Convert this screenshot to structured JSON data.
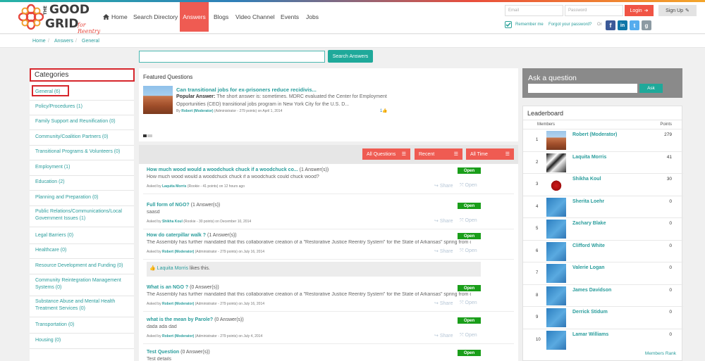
{
  "header": {
    "logo": {
      "line1": "THE",
      "line2": "GOOD",
      "line3": "GRID",
      "tagline": "for Reentry"
    },
    "nav": [
      {
        "label": "Home",
        "icon": "home-icon"
      },
      {
        "label": "Search Directory"
      },
      {
        "label": "Answers",
        "active": true
      },
      {
        "label": "Blogs"
      },
      {
        "label": "Video Channel"
      },
      {
        "label": "Events"
      },
      {
        "label": "Jobs"
      }
    ],
    "email_placeholder": "Email",
    "password_placeholder": "Password",
    "login_label": "Login",
    "signup_label": "Sign Up",
    "remember_label": "Remember me",
    "forgot_label": "Forgot your password?",
    "or_label": "Or",
    "social_icons": [
      "facebook-icon",
      "linkedin-icon",
      "twitter-icon",
      "google-icon"
    ]
  },
  "breadcrumb": [
    "Home",
    "Answers",
    "General"
  ],
  "search": {
    "button_label": "Search Answers"
  },
  "categories": {
    "title": "Categories",
    "items": [
      "General (6)",
      "Policy/Procedures (1)",
      "Family Support and Reunification (0)",
      "Community/Coalition Partners (0)",
      "Transitional Programs & Volunteers (0)",
      "Employment (1)",
      "Education (2)",
      "Planning and Preparation (0)",
      "Public Relations/Communications/Local Government Issues (1)",
      "Legal Barriers (0)",
      "Healthcare (0)",
      "Resource Development and Funding (0)",
      "Community Reintegration Management Systems (0)",
      "Substance Abuse and Mental Health Treatment Services (0)",
      "Transportation (0)",
      "Housing (0)"
    ]
  },
  "featured": {
    "title": "Featured Questions",
    "question": "Can transitional jobs for ex-prisoners reduce recidivis...",
    "popular_label": "Popular Answer:",
    "answer_line1": "The short answer is: sometimes. MDRC evaluated the Center for Employment",
    "answer_line2": "Opportunities (CEO) transitional jobs program in New York City for the U.S. D...",
    "meta_by": "By",
    "meta_user": "Robert (Moderator)",
    "meta_rest": "(Administrator - 279 points)  on April 1, 2014",
    "likes": "1"
  },
  "filters": [
    "All Questions",
    "Recent",
    "All Time"
  ],
  "questions": [
    {
      "title": "How much wood would a woodchuck chuck if a woodchuck co...",
      "count": "(1 Answer(s))",
      "excerpt": "How much wood would a woodchuck chuck if a woodchuck could chuck wood?",
      "asked": "Asked by",
      "user": "Laquita Morris",
      "meta": "(Rookie - 41 points)  on 12 hours ago",
      "status": "Open"
    },
    {
      "title": "Full form of NGO?",
      "count": "(1 Answer(s))",
      "excerpt": "saasd",
      "asked": "Asked by",
      "user": "Shikha Koul",
      "meta": "(Rookie - 30 points)  on December 10, 2014",
      "status": "Open"
    },
    {
      "title": "How do caterpillar walk ?",
      "count": "(1 Answer(s))",
      "excerpt": "The Assembly has further mandated that this collaborative creation of a \"Restorative Justice Reentry System\" for the State of Arkansas\" spring from op...",
      "asked": "Asked by",
      "user": "Robert (Moderator)",
      "meta": "(Administrator - 279 points)  on July 16, 2014",
      "status": "Open"
    },
    {
      "title": "What is an NGO ?",
      "count": "(0 Answer(s))",
      "excerpt": "The Assembly has further mandated that this collaborative creation of a \"Restorative Justice Reentry System\" for the State of Arkansas\" spring from op...",
      "asked": "Asked by",
      "user": "Robert (Moderator)",
      "meta": "(Administrator - 279 points)  on July 16, 2014",
      "status": "Open"
    },
    {
      "title": "what is the mean by Parole?",
      "count": "(0 Answer(s))",
      "excerpt": "dada ada dad",
      "asked": "Asked by",
      "user": "Robert (Moderator)",
      "meta": "(Administrator - 279 points)  on July 4, 2014",
      "status": "Open"
    },
    {
      "title": "Test Question",
      "count": "(0 Answer(s))",
      "excerpt": "Test details",
      "status": "Open"
    }
  ],
  "likes_box": {
    "user": "Laquita Morris",
    "text": "likes this."
  },
  "actions": {
    "share": "Share",
    "open": "Open"
  },
  "ask": {
    "title": "Ask a question",
    "button": "Ask"
  },
  "leaderboard": {
    "title": "Leaderboard",
    "col_members": "Members",
    "col_points": "Points",
    "rows": [
      {
        "rank": "1",
        "name": "Robert (Moderator)",
        "points": "279"
      },
      {
        "rank": "2",
        "name": "Laquita Morris",
        "points": "41"
      },
      {
        "rank": "3",
        "name": "Shikha Koul",
        "points": "30"
      },
      {
        "rank": "4",
        "name": "Sherita Loehr",
        "points": "0"
      },
      {
        "rank": "5",
        "name": "Zachary Blake",
        "points": "0"
      },
      {
        "rank": "6",
        "name": "Clifford White",
        "points": "0"
      },
      {
        "rank": "7",
        "name": "Valerie Logan",
        "points": "0"
      },
      {
        "rank": "8",
        "name": "James Davidson",
        "points": "0"
      },
      {
        "rank": "9",
        "name": "Derrick Stidum",
        "points": "0"
      },
      {
        "rank": "10",
        "name": "Lamar Williams",
        "points": "0"
      }
    ],
    "footer": "Members Rank"
  },
  "colors": {
    "accent": "#2a9d9c",
    "brand_red": "#ef5b52",
    "open_green": "#1a9e1a"
  }
}
